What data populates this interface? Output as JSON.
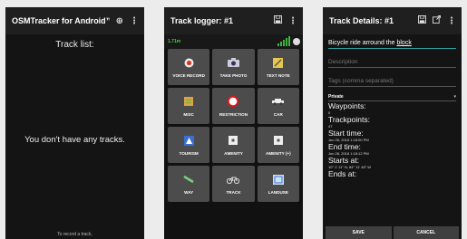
{
  "screen1": {
    "app_title": "OSMTracker for Android™",
    "list_title": "Track list:",
    "empty_message": "You don't have any tracks.",
    "hint": "To record a track,"
  },
  "screen2": {
    "title": "Track logger: #1",
    "gps_status": "1.71m",
    "buttons": [
      {
        "label": "VOICE RECORD",
        "icon": "record-icon"
      },
      {
        "label": "TAKE PHOTO",
        "icon": "camera-icon"
      },
      {
        "label": "TEXT NOTE",
        "icon": "note-icon"
      },
      {
        "label": "MISC",
        "icon": "misc-icon"
      },
      {
        "label": "RESTRICTION",
        "icon": "restriction-icon"
      },
      {
        "label": "CAR",
        "icon": "car-icon"
      },
      {
        "label": "TOURISM",
        "icon": "tourism-icon"
      },
      {
        "label": "AMENITY",
        "icon": "amenity-icon"
      },
      {
        "label": "AMENITY (+)",
        "icon": "amenity-plus-icon"
      },
      {
        "label": "WAY",
        "icon": "way-icon"
      },
      {
        "label": "TRACK",
        "icon": "bicycle-icon"
      },
      {
        "label": "LANDUSE",
        "icon": "landuse-icon"
      }
    ]
  },
  "screen3": {
    "title": "Track Details: #1",
    "name_value": "Bicycle ride arround the ",
    "name_value_underlined": "block",
    "description_placeholder": "Description",
    "tags_placeholder": "Tags (comma separated)",
    "visibility": "Private",
    "waypoints_label": "Waypoints:",
    "waypoints_value": "0",
    "trackpoints_label": "Trackpoints:",
    "trackpoints_value": "47",
    "start_label": "Start time:",
    "start_value": "Jun 28, 2018 1:18:00 PM",
    "end_label": "End time:",
    "end_value": "Jun 28, 2018 1:18:12 PM",
    "starts_label": "Starts at:",
    "starts_value": "10° 1' 11\" N, 84° 11' 48\" W",
    "ends_label": "Ends at:",
    "save": "SAVE",
    "cancel": "CANCEL"
  },
  "colors": {
    "accent": "#2fa3a3",
    "gps_green": "#4cc94c",
    "button_bg": "#4c4c4c"
  }
}
